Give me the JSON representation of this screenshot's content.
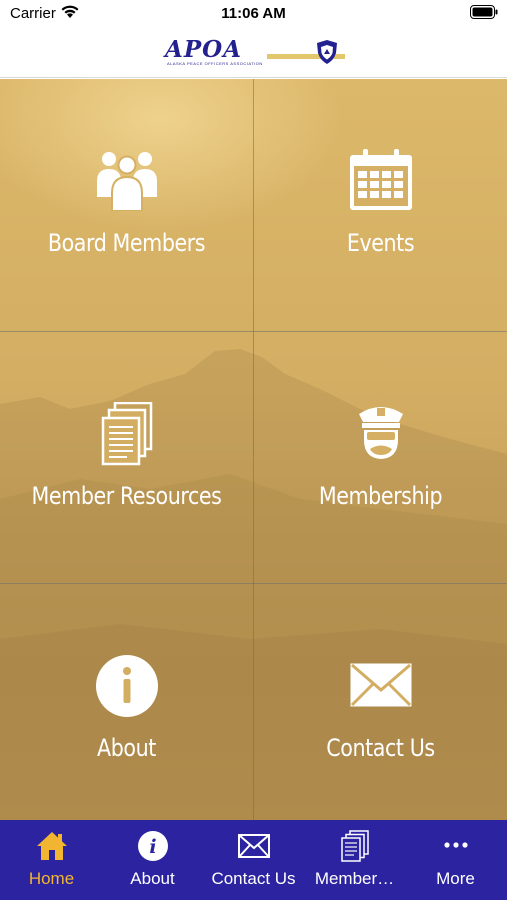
{
  "status_bar": {
    "carrier": "Carrier",
    "time": "11:06 AM"
  },
  "header": {
    "logo_text": "APOA",
    "logo_subtitle": "ALASKA PEACE OFFICERS ASSOCIATION"
  },
  "grid": {
    "tiles": [
      {
        "label": "Board Members",
        "icon": "people-group-icon"
      },
      {
        "label": "Events",
        "icon": "calendar-icon"
      },
      {
        "label": "Member Resources",
        "icon": "documents-icon"
      },
      {
        "label": "Membership",
        "icon": "police-officer-icon"
      },
      {
        "label": "About",
        "icon": "info-icon"
      },
      {
        "label": "Contact Us",
        "icon": "envelope-icon"
      }
    ]
  },
  "tabbar": {
    "active_color": "#f2b531",
    "background": "#2b23a0",
    "tabs": [
      {
        "label": "Home",
        "icon": "home-icon",
        "active": true
      },
      {
        "label": "About",
        "icon": "info-icon",
        "active": false
      },
      {
        "label": "Contact Us",
        "icon": "envelope-icon",
        "active": false
      },
      {
        "label": "Member…",
        "icon": "documents-icon",
        "active": false
      },
      {
        "label": "More",
        "icon": "more-dots-icon",
        "active": false
      }
    ]
  }
}
